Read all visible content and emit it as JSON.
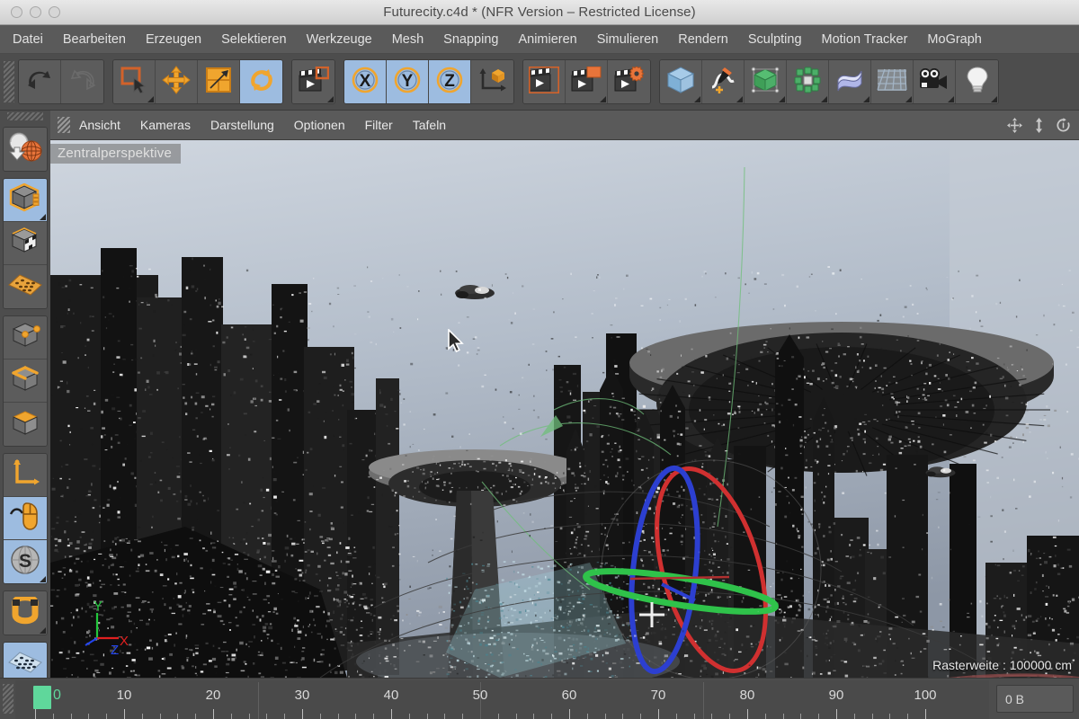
{
  "window": {
    "title": "Futurecity.c4d * (NFR Version – Restricted License)",
    "traffic_lights": [
      "close",
      "minimize",
      "zoom"
    ]
  },
  "menubar": {
    "items": [
      {
        "label": "Datei"
      },
      {
        "label": "Bearbeiten"
      },
      {
        "label": "Erzeugen"
      },
      {
        "label": "Selektieren"
      },
      {
        "label": "Werkzeuge"
      },
      {
        "label": "Mesh"
      },
      {
        "label": "Snapping"
      },
      {
        "label": "Animieren"
      },
      {
        "label": "Simulieren"
      },
      {
        "label": "Rendern"
      },
      {
        "label": "Sculpting"
      },
      {
        "label": "Motion Tracker"
      },
      {
        "label": "MoGraph"
      }
    ]
  },
  "toolbar": {
    "groups": [
      {
        "name": "history",
        "buttons": [
          {
            "icon": "undo-icon",
            "active": false,
            "menu": false
          },
          {
            "icon": "redo-icon",
            "active": false,
            "menu": false
          }
        ]
      },
      {
        "name": "transform",
        "buttons": [
          {
            "icon": "live-selection-icon",
            "active": false,
            "menu": true
          },
          {
            "icon": "move-icon",
            "active": false,
            "menu": false
          },
          {
            "icon": "scale-icon",
            "active": false,
            "menu": false
          },
          {
            "icon": "rotate-icon",
            "active": true,
            "menu": false
          }
        ]
      },
      {
        "name": "render-left",
        "buttons": [
          {
            "icon": "render-view-icon",
            "active": false,
            "menu": true
          }
        ]
      },
      {
        "name": "axis-lock",
        "buttons": [
          {
            "icon": "axis-x-icon",
            "active": true,
            "menu": false
          },
          {
            "icon": "axis-y-icon",
            "active": true,
            "menu": false
          },
          {
            "icon": "axis-z-icon",
            "active": true,
            "menu": false
          },
          {
            "icon": "world-coordinates-icon",
            "active": false,
            "menu": false
          }
        ]
      },
      {
        "name": "render",
        "buttons": [
          {
            "icon": "render-region-icon",
            "active": false,
            "menu": false
          },
          {
            "icon": "render-to-picture-viewer-icon",
            "active": false,
            "menu": true
          },
          {
            "icon": "render-settings-icon",
            "active": false,
            "menu": false
          }
        ]
      },
      {
        "name": "create",
        "buttons": [
          {
            "icon": "primitive-cube-icon",
            "active": false,
            "menu": true
          },
          {
            "icon": "spline-pen-icon",
            "active": false,
            "menu": true
          },
          {
            "icon": "generator-nurbs-icon",
            "active": false,
            "menu": true
          },
          {
            "icon": "mograph-cloner-icon",
            "active": false,
            "menu": true
          },
          {
            "icon": "deformer-bend-icon",
            "active": false,
            "menu": true
          },
          {
            "icon": "scene-floor-icon",
            "active": false,
            "menu": true
          },
          {
            "icon": "camera-icon",
            "active": false,
            "menu": true
          },
          {
            "icon": "light-icon",
            "active": false,
            "menu": true
          }
        ]
      }
    ]
  },
  "left_toolbar": {
    "groups": [
      {
        "buttons": [
          {
            "icon": "make-editable-icon",
            "active": false,
            "menu": false
          }
        ]
      },
      {
        "buttons": [
          {
            "icon": "model-mode-icon",
            "active": true,
            "menu": true
          },
          {
            "icon": "texture-mode-icon",
            "active": false,
            "menu": false
          },
          {
            "icon": "workplane-mode-icon",
            "active": false,
            "menu": false
          }
        ]
      },
      {
        "buttons": [
          {
            "icon": "point-mode-icon",
            "active": false,
            "menu": false
          },
          {
            "icon": "edge-mode-icon",
            "active": false,
            "menu": false
          },
          {
            "icon": "polygon-mode-icon",
            "active": false,
            "menu": false
          }
        ]
      },
      {
        "buttons": [
          {
            "icon": "object-axis-icon",
            "active": false,
            "menu": false
          },
          {
            "icon": "viewport-tool-icon",
            "active": true,
            "menu": false
          },
          {
            "icon": "soft-selection-icon",
            "active": true,
            "menu": true
          }
        ]
      },
      {
        "buttons": [
          {
            "icon": "snap-magnet-icon",
            "active": false,
            "menu": true
          }
        ]
      },
      {
        "buttons": [
          {
            "icon": "grid-snap-icon",
            "active": true,
            "menu": false
          }
        ]
      }
    ]
  },
  "viewport": {
    "menu": [
      {
        "label": "Ansicht"
      },
      {
        "label": "Kameras"
      },
      {
        "label": "Darstellung"
      },
      {
        "label": "Optionen"
      },
      {
        "label": "Filter"
      },
      {
        "label": "Tafeln"
      }
    ],
    "nav_icons": [
      {
        "icon": "pan-view-icon"
      },
      {
        "icon": "dolly-view-icon"
      },
      {
        "icon": "rotate-view-icon"
      }
    ],
    "label": "Zentralperspektive",
    "info": "Rasterweite : 100000 cm",
    "axis_gizmo": {
      "y_label": "Y",
      "y_color": "#22c83c",
      "x_label": "X",
      "x_color": "#e02020",
      "z_label": "Z",
      "z_color": "#2244ee"
    },
    "rotate_gizmo": {
      "band_x_color": "#d03030",
      "band_y_color": "#2fc24a",
      "band_z_color": "#2c3fd0"
    },
    "scene": "futuristic-city-with-flying-saucers"
  },
  "timeline": {
    "current_frame": "0",
    "frame_min": 0,
    "frame_max": 100,
    "major_step": 10,
    "minor_step": 2,
    "labels": [
      "0",
      "10",
      "20",
      "30",
      "40",
      "50",
      "60",
      "70",
      "80",
      "90",
      "100"
    ],
    "memory_usage": "0 B"
  },
  "colors": {
    "accent_orange": "#f0a52e",
    "active_blue": "#9dbce0",
    "panel_gray": "#4d4d4d",
    "menu_gray": "#5a5a5a",
    "playhead_green": "#5fd79b"
  }
}
